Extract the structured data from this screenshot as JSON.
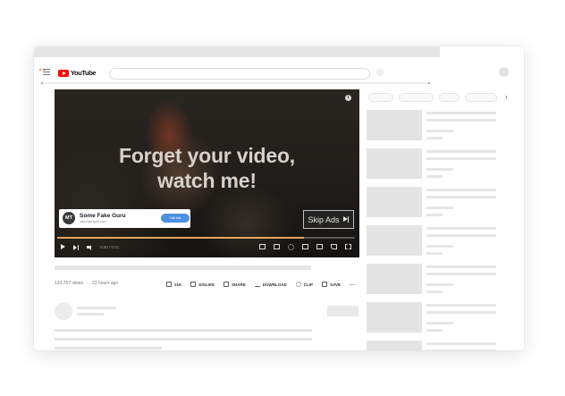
{
  "brand": {
    "name": "YouTube",
    "red": "#ff0000"
  },
  "window_dots": [
    "#ff5f57",
    "#febc2e",
    "#28c840"
  ],
  "player": {
    "headline_line1": "Forget your video,",
    "headline_line2": "watch me!",
    "info_icon": "i",
    "ad": {
      "avatar_initials": "MT",
      "advertiser_name": "Some Fake Guru",
      "advertiser_url": "www.fakeguru.com",
      "cta_label": "Visit site"
    },
    "skip_label": "Skip Ads",
    "progress": 0.83,
    "progress_color": "#e4a45c",
    "time": "0:00 / 0:31"
  },
  "video_meta": {
    "views": "133,757 views",
    "age": "23 hours ago"
  },
  "actions": {
    "like_count": "21K",
    "dislike_label": "DISLIKE",
    "share_label": "SHARE",
    "download_label": "DOWNLOAD",
    "clip_label": "CLIP",
    "save_label": "SAVE",
    "more_label": "..."
  },
  "icons": {
    "hamburger": "menu-icon",
    "like": "thumbs-up-icon",
    "dislike": "thumbs-down-icon",
    "share": "share-icon",
    "download": "download-icon",
    "clip": "scissors-icon",
    "save": "playlist-add-icon"
  },
  "chevron": "›"
}
